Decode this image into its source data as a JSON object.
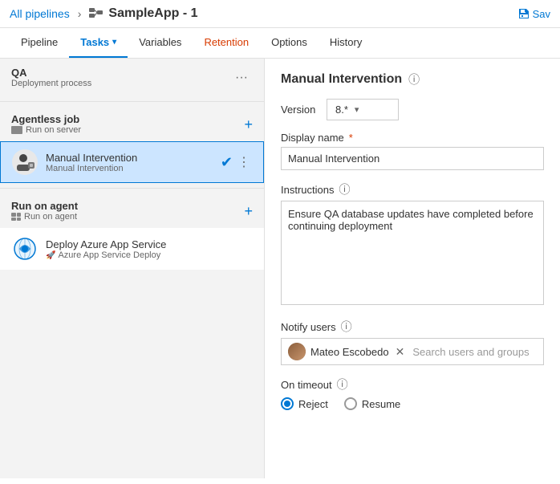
{
  "header": {
    "breadcrumb_text": "All pipelines",
    "pipeline_name": "SampleApp - 1",
    "save_label": "Sav"
  },
  "nav": {
    "tabs": [
      {
        "id": "pipeline",
        "label": "Pipeline",
        "active": false
      },
      {
        "id": "tasks",
        "label": "Tasks",
        "active": true,
        "has_chevron": true
      },
      {
        "id": "variables",
        "label": "Variables",
        "active": false
      },
      {
        "id": "retention",
        "label": "Retention",
        "active": false,
        "orange": true
      },
      {
        "id": "options",
        "label": "Options",
        "active": false
      },
      {
        "id": "history",
        "label": "History",
        "active": false
      }
    ]
  },
  "left_panel": {
    "stage": {
      "name": "QA",
      "sub": "Deployment process"
    },
    "job_agentless": {
      "title": "Agentless job",
      "sub": "Run on server"
    },
    "task_manual": {
      "name": "Manual Intervention",
      "sub": "Manual Intervention",
      "selected": true
    },
    "job_agent": {
      "title": "Run on agent",
      "sub": "Run on agent"
    },
    "task_azure": {
      "name": "Deploy Azure App Service",
      "sub": "Azure App Service Deploy"
    }
  },
  "right_panel": {
    "title": "Manual Intervention",
    "version_label": "Version",
    "version_value": "8.*",
    "display_name_label": "Display name",
    "display_name_required": "*",
    "display_name_value": "Manual Intervention",
    "instructions_label": "Instructions",
    "instructions_value": "Ensure QA database updates have completed before continuing deployment",
    "notify_users_label": "Notify users",
    "notify_user_name": "Mateo Escobedo",
    "notify_placeholder": "Search users and groups",
    "on_timeout_label": "On timeout",
    "timeout_reject": "Reject",
    "timeout_resume": "Resume"
  }
}
